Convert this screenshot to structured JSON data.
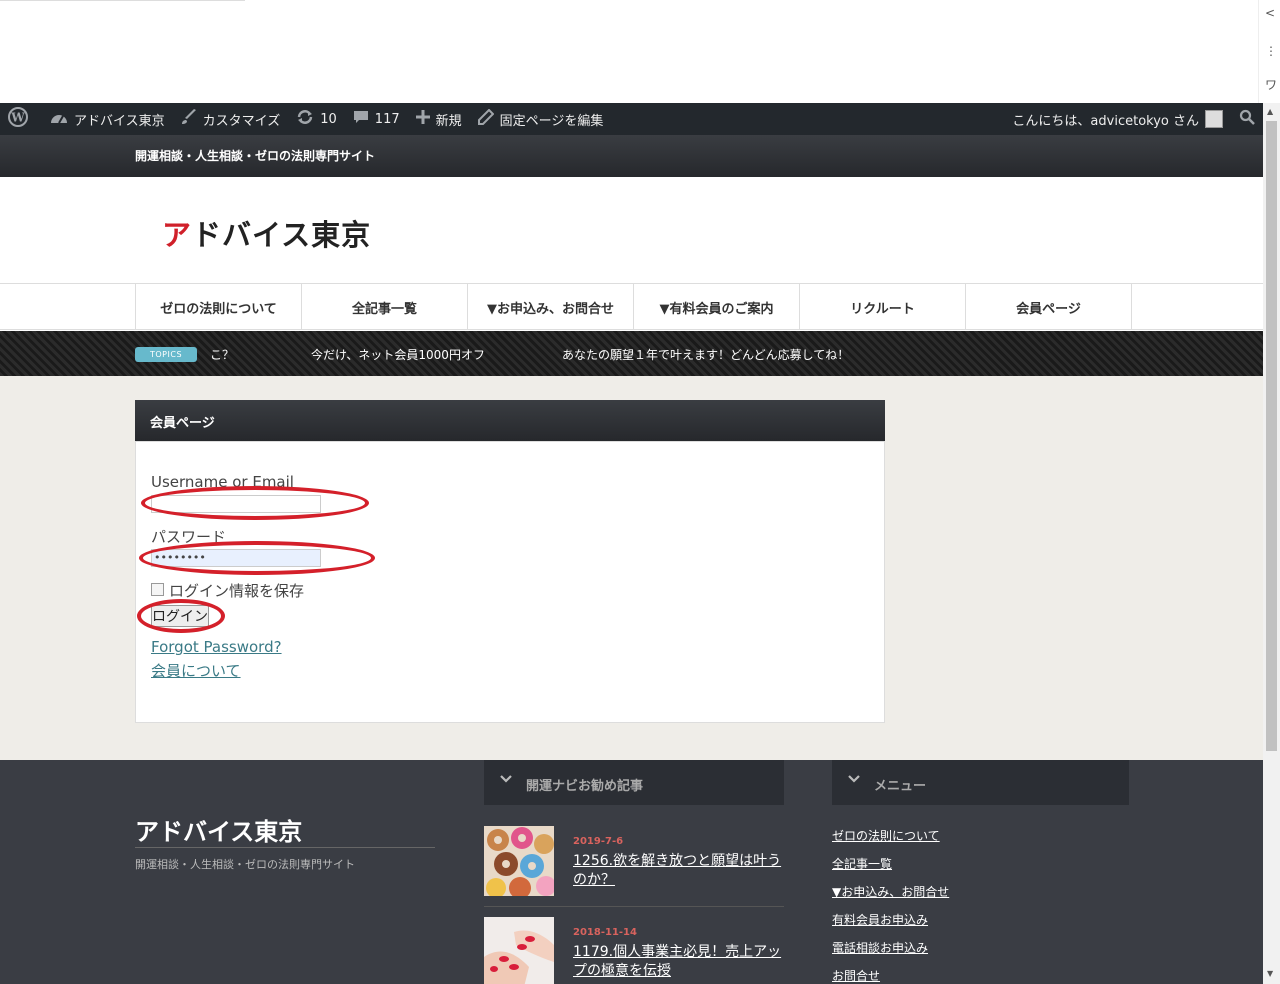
{
  "browser": {
    "side_glyphs": [
      "<",
      "⋮",
      "ワ"
    ]
  },
  "adminbar": {
    "items": [
      {
        "icon": "wordpress-icon",
        "label": ""
      },
      {
        "icon": "dashboard-icon",
        "label": "アドバイス東京"
      },
      {
        "icon": "brush-icon",
        "label": "カスタマイズ"
      },
      {
        "icon": "update-icon",
        "label": "10"
      },
      {
        "icon": "comment-icon",
        "label": "117"
      },
      {
        "icon": "plus-icon",
        "label": "新規"
      },
      {
        "icon": "pencil-icon",
        "label": "固定ページを編集"
      }
    ],
    "greeting": "こんにちは、advicetokyo さん"
  },
  "site": {
    "tagline": "開運相談・人生相談・ゼロの法則専門サイト",
    "logo_first": "ア",
    "logo_rest": "ドバイス東京"
  },
  "nav": {
    "items": [
      "ゼロの法則について",
      "全記事一覧",
      "▼お申込み、お問合せ",
      "▼有料会員のご案内",
      "リクルート",
      "会員ページ"
    ]
  },
  "topics": {
    "badge": "TOPICS",
    "items": [
      "こ？",
      "今だけ、ネット会員1000円オフ",
      "あなたの願望１年で叶えます！どんどん応募してね！"
    ]
  },
  "panel": {
    "title": "会員ページ",
    "username_label": "Username or Email",
    "username_value": "",
    "password_label": "パスワード",
    "password_value": "••••••••",
    "remember_label": "ログイン情報を保存",
    "login_button": "ログイン",
    "forgot_link": "Forgot Password?",
    "about_link": "会員について"
  },
  "footer": {
    "logo": "アドバイス東京",
    "tagline": "開運相談・人生相談・ゼロの法則専門サイト",
    "posts_heading": "開運ナビお勧め記事",
    "menu_heading": "メニュー",
    "posts": [
      {
        "date": "2019-7-6",
        "title": "1256.欲を解き放つと願望は叶うのか？"
      },
      {
        "date": "2018-11-14",
        "title": "1179.個人事業主必見！売上アップの極意を伝授"
      }
    ],
    "menu": [
      "ゼロの法則について",
      "全記事一覧",
      "▼お申込み、お問合せ",
      "有料会員お申込み",
      "電話相談お申込み",
      "お問合せ"
    ]
  },
  "colors": {
    "accent_red": "#d0202a",
    "link_teal": "#3a7a86",
    "topics_badge": "#67b9cc",
    "date_red": "#d9635e"
  }
}
